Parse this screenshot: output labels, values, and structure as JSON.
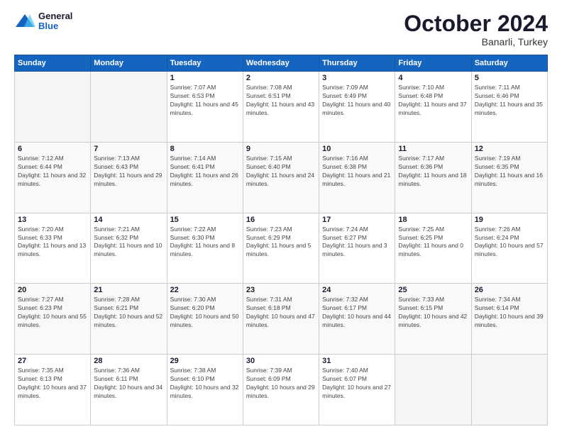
{
  "header": {
    "logo_line1": "General",
    "logo_line2": "Blue",
    "month": "October 2024",
    "location": "Banarli, Turkey"
  },
  "weekdays": [
    "Sunday",
    "Monday",
    "Tuesday",
    "Wednesday",
    "Thursday",
    "Friday",
    "Saturday"
  ],
  "weeks": [
    [
      {
        "day": "",
        "info": ""
      },
      {
        "day": "",
        "info": ""
      },
      {
        "day": "1",
        "info": "Sunrise: 7:07 AM\nSunset: 6:53 PM\nDaylight: 11 hours and 45 minutes."
      },
      {
        "day": "2",
        "info": "Sunrise: 7:08 AM\nSunset: 6:51 PM\nDaylight: 11 hours and 43 minutes."
      },
      {
        "day": "3",
        "info": "Sunrise: 7:09 AM\nSunset: 6:49 PM\nDaylight: 11 hours and 40 minutes."
      },
      {
        "day": "4",
        "info": "Sunrise: 7:10 AM\nSunset: 6:48 PM\nDaylight: 11 hours and 37 minutes."
      },
      {
        "day": "5",
        "info": "Sunrise: 7:11 AM\nSunset: 6:46 PM\nDaylight: 11 hours and 35 minutes."
      }
    ],
    [
      {
        "day": "6",
        "info": "Sunrise: 7:12 AM\nSunset: 6:44 PM\nDaylight: 11 hours and 32 minutes."
      },
      {
        "day": "7",
        "info": "Sunrise: 7:13 AM\nSunset: 6:43 PM\nDaylight: 11 hours and 29 minutes."
      },
      {
        "day": "8",
        "info": "Sunrise: 7:14 AM\nSunset: 6:41 PM\nDaylight: 11 hours and 26 minutes."
      },
      {
        "day": "9",
        "info": "Sunrise: 7:15 AM\nSunset: 6:40 PM\nDaylight: 11 hours and 24 minutes."
      },
      {
        "day": "10",
        "info": "Sunrise: 7:16 AM\nSunset: 6:38 PM\nDaylight: 11 hours and 21 minutes."
      },
      {
        "day": "11",
        "info": "Sunrise: 7:17 AM\nSunset: 6:36 PM\nDaylight: 11 hours and 18 minutes."
      },
      {
        "day": "12",
        "info": "Sunrise: 7:19 AM\nSunset: 6:35 PM\nDaylight: 11 hours and 16 minutes."
      }
    ],
    [
      {
        "day": "13",
        "info": "Sunrise: 7:20 AM\nSunset: 6:33 PM\nDaylight: 11 hours and 13 minutes."
      },
      {
        "day": "14",
        "info": "Sunrise: 7:21 AM\nSunset: 6:32 PM\nDaylight: 11 hours and 10 minutes."
      },
      {
        "day": "15",
        "info": "Sunrise: 7:22 AM\nSunset: 6:30 PM\nDaylight: 11 hours and 8 minutes."
      },
      {
        "day": "16",
        "info": "Sunrise: 7:23 AM\nSunset: 6:29 PM\nDaylight: 11 hours and 5 minutes."
      },
      {
        "day": "17",
        "info": "Sunrise: 7:24 AM\nSunset: 6:27 PM\nDaylight: 11 hours and 3 minutes."
      },
      {
        "day": "18",
        "info": "Sunrise: 7:25 AM\nSunset: 6:25 PM\nDaylight: 11 hours and 0 minutes."
      },
      {
        "day": "19",
        "info": "Sunrise: 7:26 AM\nSunset: 6:24 PM\nDaylight: 10 hours and 57 minutes."
      }
    ],
    [
      {
        "day": "20",
        "info": "Sunrise: 7:27 AM\nSunset: 6:23 PM\nDaylight: 10 hours and 55 minutes."
      },
      {
        "day": "21",
        "info": "Sunrise: 7:28 AM\nSunset: 6:21 PM\nDaylight: 10 hours and 52 minutes."
      },
      {
        "day": "22",
        "info": "Sunrise: 7:30 AM\nSunset: 6:20 PM\nDaylight: 10 hours and 50 minutes."
      },
      {
        "day": "23",
        "info": "Sunrise: 7:31 AM\nSunset: 6:18 PM\nDaylight: 10 hours and 47 minutes."
      },
      {
        "day": "24",
        "info": "Sunrise: 7:32 AM\nSunset: 6:17 PM\nDaylight: 10 hours and 44 minutes."
      },
      {
        "day": "25",
        "info": "Sunrise: 7:33 AM\nSunset: 6:15 PM\nDaylight: 10 hours and 42 minutes."
      },
      {
        "day": "26",
        "info": "Sunrise: 7:34 AM\nSunset: 6:14 PM\nDaylight: 10 hours and 39 minutes."
      }
    ],
    [
      {
        "day": "27",
        "info": "Sunrise: 7:35 AM\nSunset: 6:13 PM\nDaylight: 10 hours and 37 minutes."
      },
      {
        "day": "28",
        "info": "Sunrise: 7:36 AM\nSunset: 6:11 PM\nDaylight: 10 hours and 34 minutes."
      },
      {
        "day": "29",
        "info": "Sunrise: 7:38 AM\nSunset: 6:10 PM\nDaylight: 10 hours and 32 minutes."
      },
      {
        "day": "30",
        "info": "Sunrise: 7:39 AM\nSunset: 6:09 PM\nDaylight: 10 hours and 29 minutes."
      },
      {
        "day": "31",
        "info": "Sunrise: 7:40 AM\nSunset: 6:07 PM\nDaylight: 10 hours and 27 minutes."
      },
      {
        "day": "",
        "info": ""
      },
      {
        "day": "",
        "info": ""
      }
    ]
  ]
}
